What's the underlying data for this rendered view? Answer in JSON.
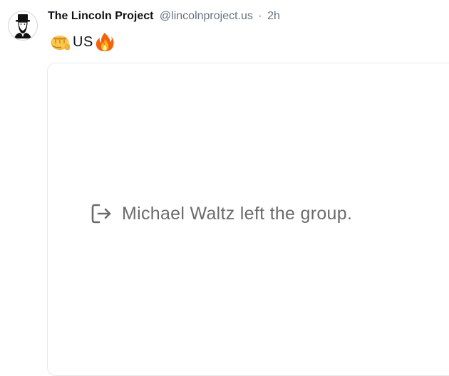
{
  "post": {
    "author_name": "The Lincoln Project",
    "handle": "@lincolnproject.us",
    "separator": "·",
    "time": "2h",
    "text_parts": {
      "emoji_left": "oncoming-fist-emoji",
      "text": "US",
      "emoji_right": "fire-emoji"
    }
  },
  "media": {
    "system_message": "Michael Waltz left the group.",
    "icon": "leave-group-icon"
  },
  "colors": {
    "text_primary": "#0f1419",
    "text_secondary": "#66727f",
    "card_border": "#e6e9ec",
    "message_gray": "#6b6b6b"
  }
}
